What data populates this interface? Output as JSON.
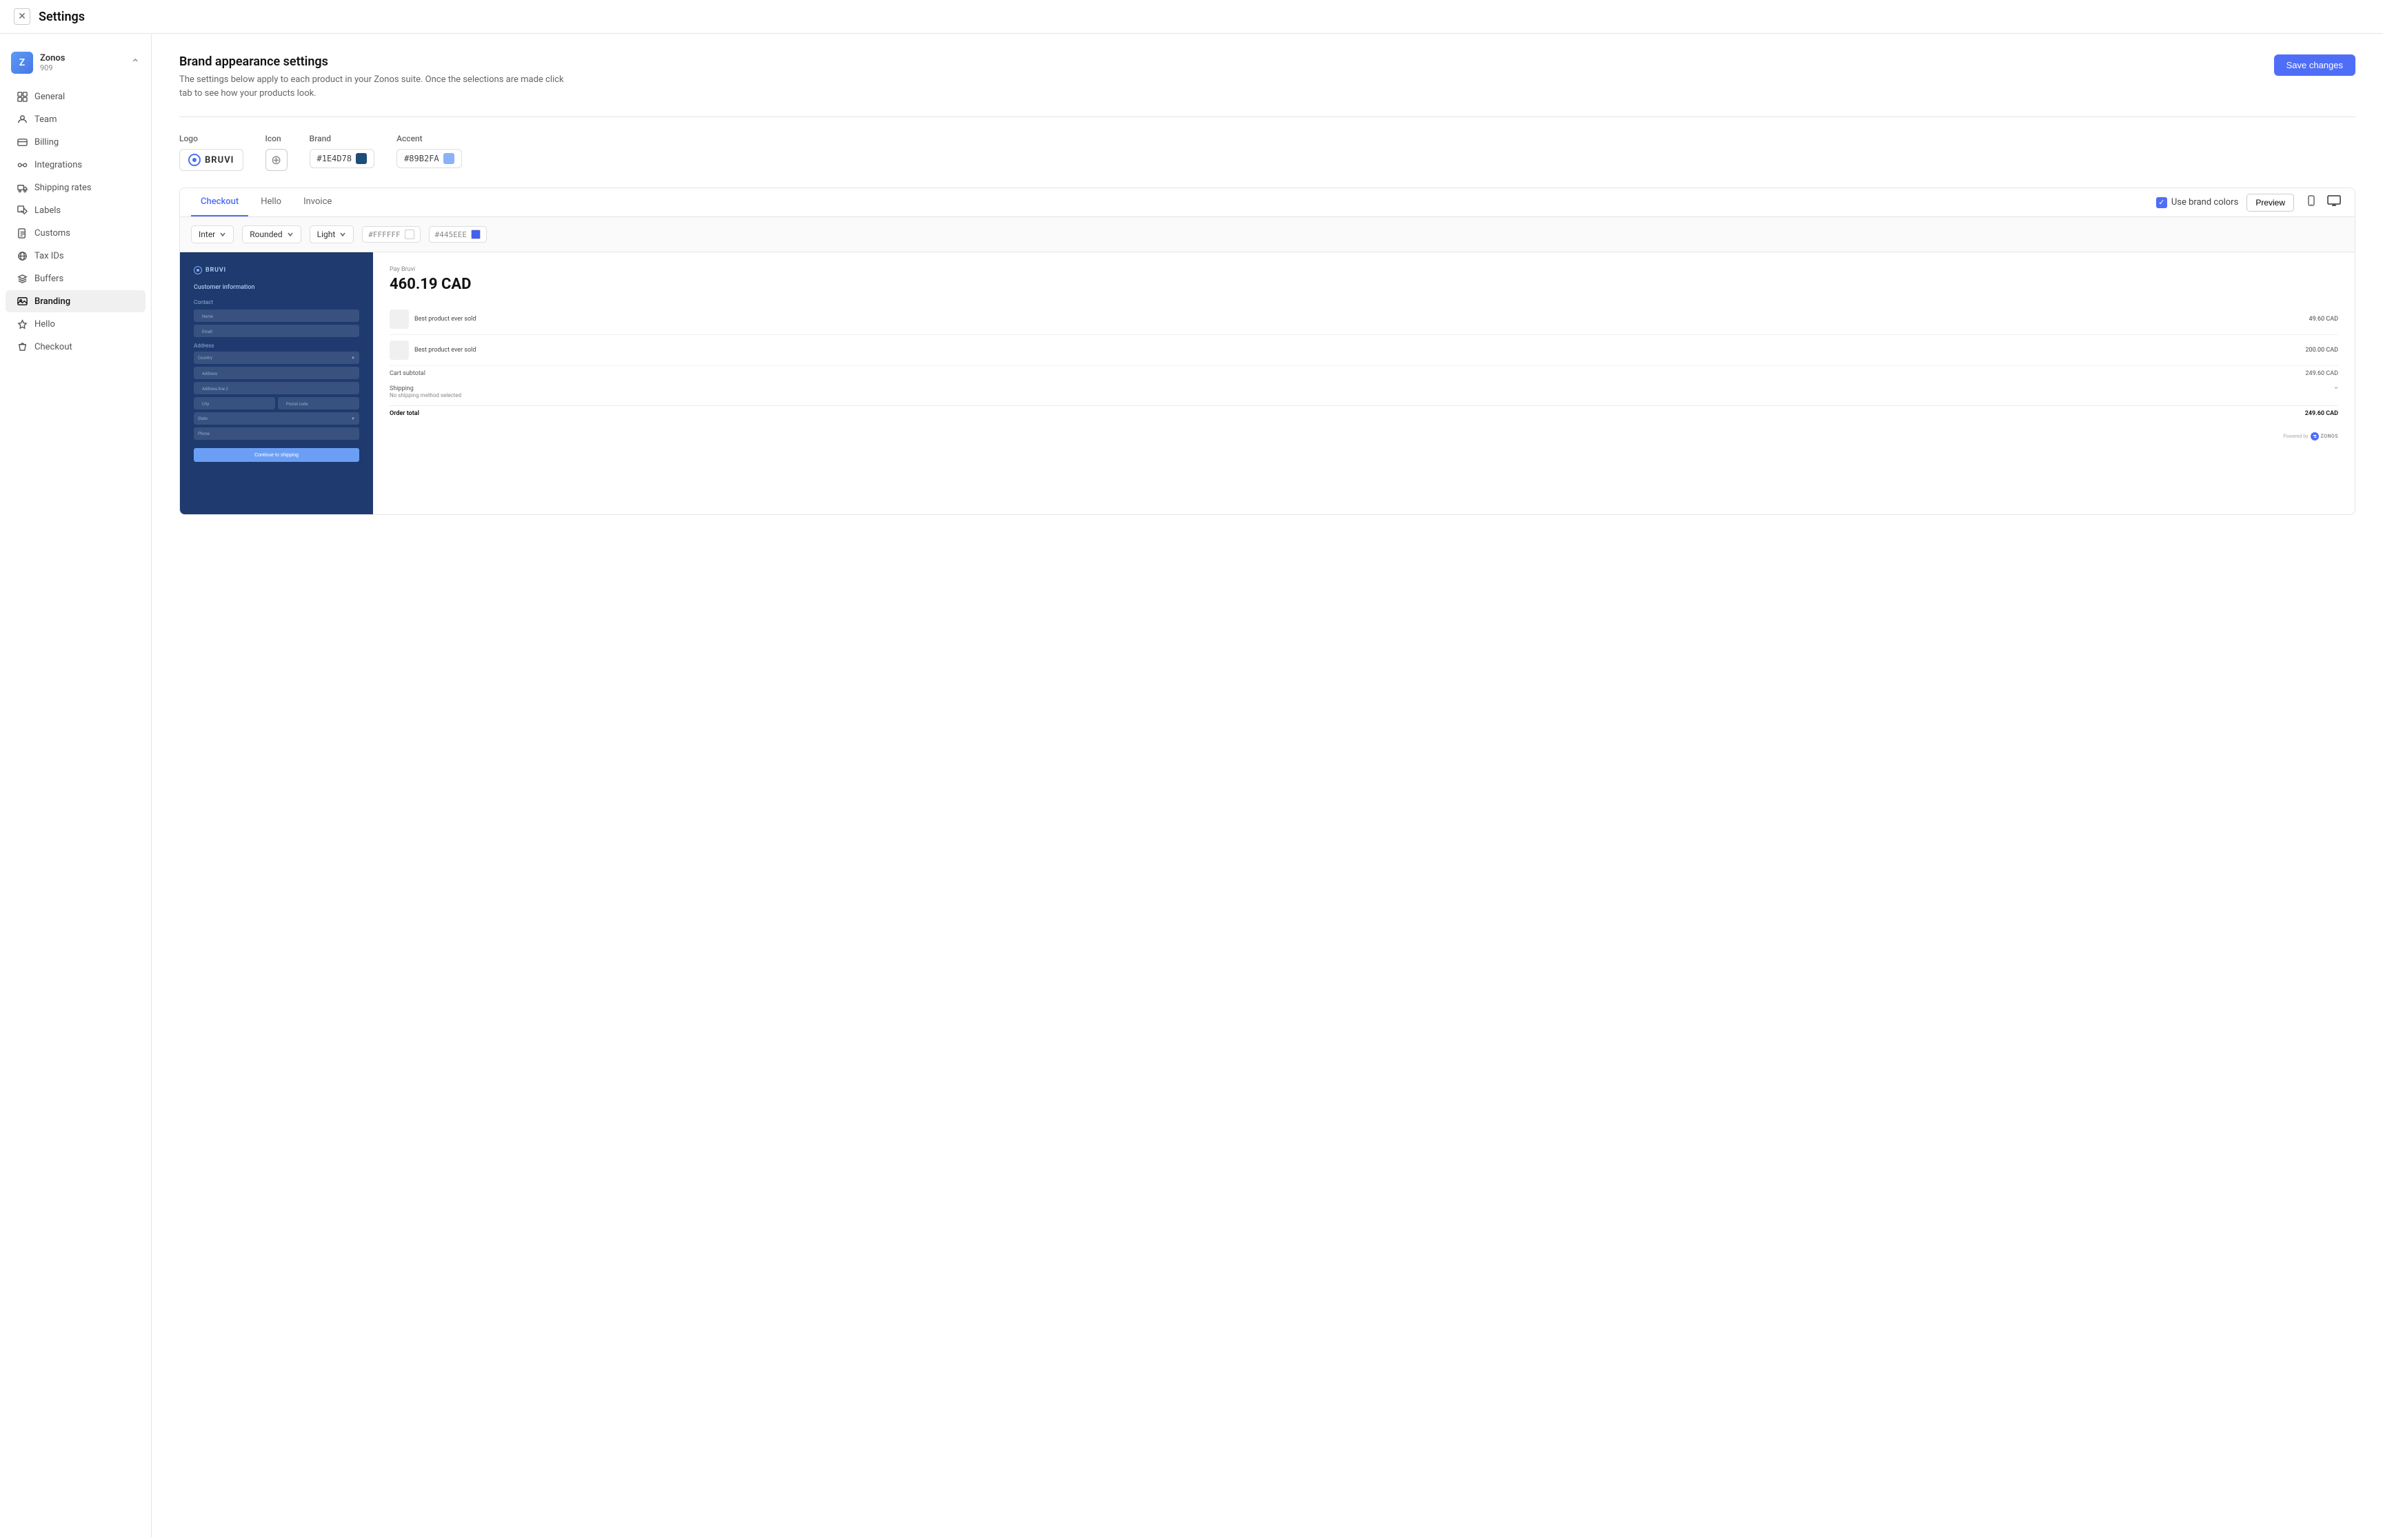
{
  "window": {
    "title": "Settings"
  },
  "org": {
    "initial": "Z",
    "name": "Zonos",
    "id": "909"
  },
  "sidebar": {
    "items": [
      {
        "id": "general",
        "label": "General",
        "icon": "grid"
      },
      {
        "id": "team",
        "label": "Team",
        "icon": "user"
      },
      {
        "id": "billing",
        "label": "Billing",
        "icon": "credit-card"
      },
      {
        "id": "integrations",
        "label": "Integrations",
        "icon": "link"
      },
      {
        "id": "shipping-rates",
        "label": "Shipping rates",
        "icon": "truck"
      },
      {
        "id": "labels",
        "label": "Labels",
        "icon": "tag"
      },
      {
        "id": "customs",
        "label": "Customs",
        "icon": "file-text"
      },
      {
        "id": "tax-ids",
        "label": "Tax IDs",
        "icon": "globe"
      },
      {
        "id": "buffers",
        "label": "Buffers",
        "icon": "layers"
      },
      {
        "id": "branding",
        "label": "Branding",
        "icon": "image",
        "active": true
      },
      {
        "id": "hello",
        "label": "Hello",
        "icon": "star"
      },
      {
        "id": "checkout",
        "label": "Checkout",
        "icon": "shopping-bag"
      }
    ]
  },
  "page": {
    "title": "Brand appearance settings",
    "subtitle": "The settings below apply to each product in your Zonos suite. Once the selections are made click tab to see how your products look.",
    "save_button": "Save changes"
  },
  "brand_controls": {
    "logo_label": "Logo",
    "icon_label": "Icon",
    "brand_label": "Brand",
    "accent_label": "Accent",
    "brand_color": "#1E4D78",
    "accent_color": "#89B2FA",
    "logo_name": "BRUVI"
  },
  "preview": {
    "tabs": [
      "Checkout",
      "Hello",
      "Invoice"
    ],
    "active_tab": "Checkout",
    "use_brand_colors_label": "Use brand colors",
    "preview_button": "Preview",
    "font": "Inter",
    "style": "Rounded",
    "weight": "Light",
    "color1": "#FFFFFF",
    "color2": "#445EEE",
    "checkout": {
      "logo_name": "BRUVI",
      "section_title": "Customer information",
      "contact_label": "Contact",
      "name_placeholder": "Name",
      "email_placeholder": "Email",
      "address_label": "Address",
      "country_placeholder": "Country",
      "address_placeholder": "Address",
      "address_line2_placeholder": "Address line 2",
      "city_placeholder": "City",
      "postal_placeholder": "Postal code",
      "state_placeholder": "State",
      "phone_placeholder": "Phone",
      "continue_button": "Continue to shipping"
    },
    "order_summary": {
      "pay_brand": "Pay Bruvi",
      "amount": "460.19 CAD",
      "items": [
        {
          "name": "Best product ever sold",
          "price": "49.60 CAD"
        },
        {
          "name": "Best product ever sold",
          "price": "200.00 CAD"
        }
      ],
      "cart_subtotal_label": "Cart subtotal",
      "cart_subtotal": "249.60 CAD",
      "shipping_label": "Shipping",
      "shipping_value": "–",
      "shipping_note": "No shipping method selected",
      "order_total_label": "Order total",
      "order_total": "249.60 CAD",
      "powered_by": "Powered by",
      "zonos_label": "ZONOS"
    }
  }
}
